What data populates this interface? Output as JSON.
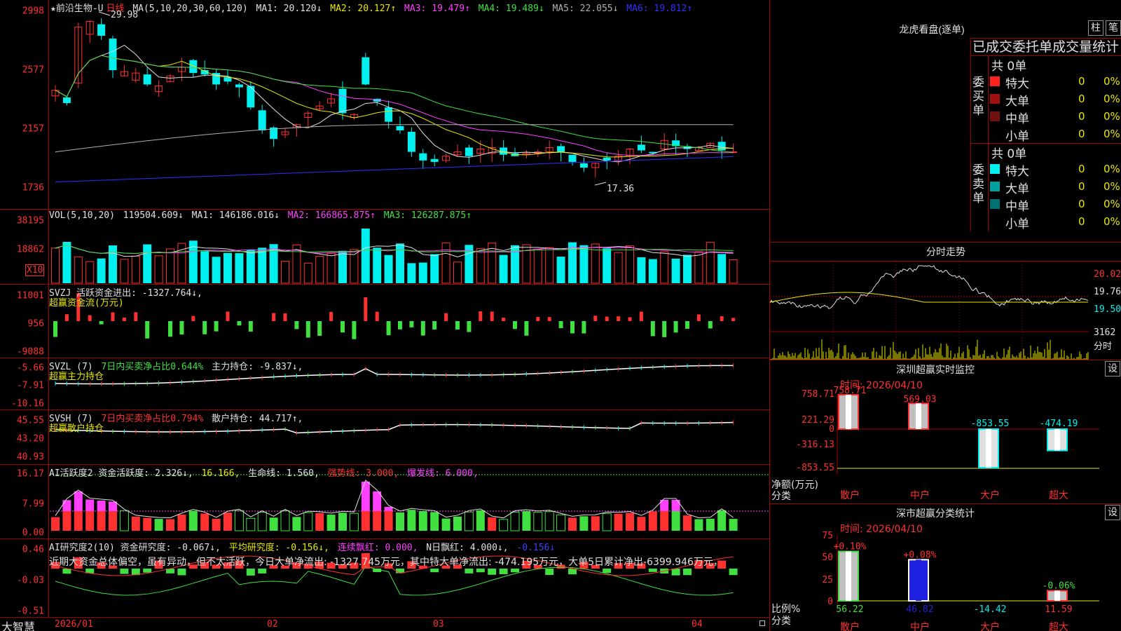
{
  "colors": {
    "up": "#ff3030",
    "down": "#00f0f0",
    "bg": "#000000",
    "grid": "#a00000",
    "white_line": "#e0e0e0",
    "yellow": "#e8e800",
    "magenta": "#ff40ff",
    "green": "#40e040",
    "blue": "#3030ff",
    "gray": "#b0b0b0"
  },
  "stock": {
    "star": "★",
    "name": "前沿生物-U",
    "period": "日线"
  },
  "main": {
    "ma_params": "MA(5,10,20,30,60,120)",
    "ma_values": [
      {
        "label": "MA1: 20.120↓",
        "color": "#e0e0e0"
      },
      {
        "label": "MA2: 20.127↑",
        "color": "#e8e800"
      },
      {
        "label": "MA3: 19.479↑",
        "color": "#ff40ff"
      },
      {
        "label": "MA4: 19.489↓",
        "color": "#40e040"
      },
      {
        "label": "MA5: 22.055↓",
        "color": "#b0b0b0"
      },
      {
        "label": "MA6: 19.812↑",
        "color": "#3030ff"
      }
    ],
    "y_labels": [
      "2998",
      "2577",
      "2157",
      "1736"
    ],
    "high_label": "29.98",
    "low_label": "17.36"
  },
  "vol": {
    "header": "VOL(5,10,20)",
    "value": "119504.609↓",
    "ma": [
      {
        "label": "MA1: 146186.016↓",
        "color": "#e0e0e0"
      },
      {
        "label": "MA2: 166865.875↑",
        "color": "#ff40ff"
      },
      {
        "label": "MA3: 126287.875↑",
        "color": "#40e040"
      }
    ],
    "y_labels": [
      "38195",
      "18862"
    ],
    "unit": "X10"
  },
  "svzj": {
    "header": "SVZJ  活跃资金进出: -1327.764↓,",
    "sub": "超赢资金流(万元)",
    "y_labels": [
      "11001",
      "956",
      "-9088"
    ]
  },
  "svzl": {
    "header_a": "SVZL (7)",
    "header_b": "7日内买卖净占比0.644%",
    "header_c": "主力持仓: -9.837↓,",
    "sub": "超赢主力持仓",
    "y_labels": [
      "-5.66",
      "-7.91",
      "-10.16"
    ]
  },
  "svsh": {
    "header_a": "SVSH (7)",
    "header_b": "7日内买卖净占比0.794%",
    "header_c": "散户持仓: 44.717↑,",
    "sub": "超赢散户持仓",
    "y_labels": [
      "45.55",
      "43.20",
      "40.93"
    ]
  },
  "ai1": {
    "header_a": "AI活跃度2 资金活跃度: 2.326↓,",
    "header_b": "16.166,",
    "header_c": "生命线: 1.560,",
    "header_d": "强势线: 3.000,",
    "header_e": "爆发线: 6.000,",
    "y_labels": [
      "16.17",
      "7.99",
      "0.00"
    ]
  },
  "ai2": {
    "header_a": "AI研究度2(10) 资金研究度: -0.067↓,",
    "header_b": "平均研究度: -0.156↓,",
    "header_c": "连续飘红: 0.000,",
    "header_d": "N日飘红: 4.000↓,",
    "header_e": "-0.156↓",
    "text": "近期大资金总体偏空，虽有异动，但不太活跃，今日大单净流出: -1327.745万元，其中特大单净流出: -474.195万元，大单5日累计净出-6399.946万元，",
    "y_labels": [
      "0.46",
      "-0.03",
      "-0.51"
    ]
  },
  "xaxis": {
    "brand": "大智慧",
    "labels": [
      "2026/01",
      "02",
      "03",
      "04"
    ]
  },
  "lhb": {
    "title": "龙虎看盘(逐单)",
    "btn1": "柱",
    "btn2": "笔",
    "tabs": "已成交委托单成交量统计",
    "buy_label": "委买单",
    "sell_label": "委卖单",
    "buy_total": "共 0单",
    "sell_total": "共 0单",
    "buy_rows": [
      {
        "name": "特大",
        "count": "0",
        "pct": "0%",
        "color": "#ff2020"
      },
      {
        "name": "大单",
        "count": "0",
        "pct": "0%",
        "color": "#a01010"
      },
      {
        "name": "中单",
        "count": "0",
        "pct": "0%",
        "color": "#701010"
      },
      {
        "name": "小单",
        "count": "0",
        "pct": "0%",
        "color": "#000000"
      }
    ],
    "sell_rows": [
      {
        "name": "特大",
        "count": "0",
        "pct": "0%",
        "color": "#00f0f0"
      },
      {
        "name": "大单",
        "count": "0",
        "pct": "0%",
        "color": "#00a0a0"
      },
      {
        "name": "中单",
        "count": "0",
        "pct": "0%",
        "color": "#007070"
      },
      {
        "name": "小单",
        "count": "0",
        "pct": "0%",
        "color": "#000000"
      }
    ]
  },
  "fenshi": {
    "title": "分时走势",
    "y_labels": [
      "20.02",
      "19.76",
      "19.50"
    ],
    "vol_label": "3162",
    "vol_unit": "分时"
  },
  "monitor": {
    "title": "深圳超赢实时监控",
    "btn": "设",
    "time": "时间: 2026/04/10",
    "y_labels": [
      "758.71",
      "221.29",
      "0",
      "-316.13",
      "-853.55"
    ],
    "bottom_label_1": "净额(万元)",
    "bottom_label_2": "分类",
    "categories": [
      "散户",
      "中户",
      "大户",
      "超大"
    ],
    "values": [
      758.71,
      569.03,
      -853.55,
      -474.19
    ],
    "value_labels": [
      "758.71",
      "569.03",
      "-853.55",
      "-474.19"
    ]
  },
  "classify": {
    "title": "深市超赢分类统计",
    "btn": "设",
    "time": "时间: 2026/04/10",
    "y_labels": [
      "75",
      "50",
      "25",
      "0"
    ],
    "bottom_label_1": "比例%",
    "bottom_label_2": "分类",
    "categories": [
      "散户",
      "中户",
      "大户",
      "超大"
    ],
    "values": [
      56.22,
      46.82,
      -14.42,
      11.59
    ],
    "value_labels": [
      "56.22",
      "46.82",
      "-14.42",
      "11.59"
    ],
    "top_labels": [
      "+0.10%",
      "+0.08%",
      "",
      "-0.06%"
    ]
  }
}
